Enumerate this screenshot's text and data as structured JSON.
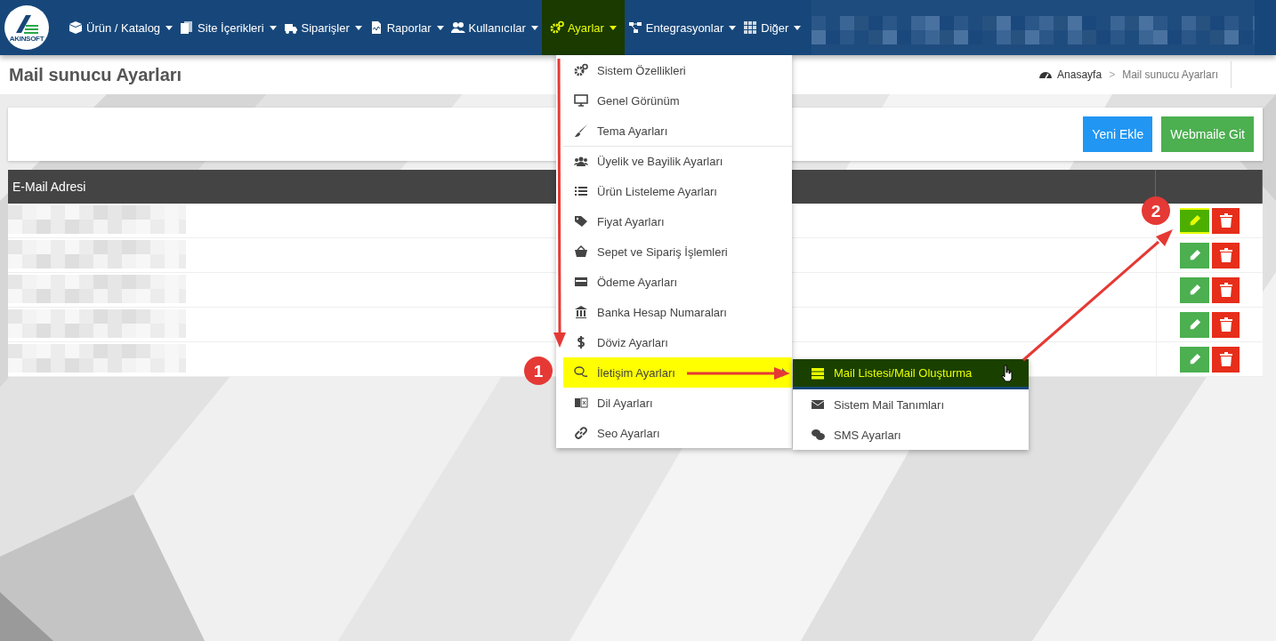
{
  "navbar": {
    "logo_text": "AKINSOFT",
    "items": [
      {
        "label": "Ürün / Katalog",
        "selected": false
      },
      {
        "label": "Site İçerikleri",
        "selected": false
      },
      {
        "label": "Siparişler",
        "selected": false
      },
      {
        "label": "Raporlar",
        "selected": false
      },
      {
        "label": "Kullanıcılar",
        "selected": false
      },
      {
        "label": "Ayarlar",
        "selected": true
      },
      {
        "label": "Entegrasyonlar",
        "selected": false
      },
      {
        "label": "Diğer",
        "selected": false
      }
    ]
  },
  "page_title": "Mail sunucu Ayarları",
  "breadcrumb": [
    "Anasayfa",
    ">",
    "Mail sunucu Ayarları"
  ],
  "toolbar": [
    {
      "label": "Yeni Ekle",
      "kind": "primary"
    },
    {
      "label": "Webmaile Git",
      "kind": "success"
    }
  ],
  "table": {
    "columns": [
      "E-Mail Adresi"
    ],
    "rows": [
      {
        "highlighted": true
      },
      {
        "highlighted": false
      },
      {
        "highlighted": false
      },
      {
        "highlighted": false
      },
      {
        "highlighted": false
      }
    ]
  },
  "dropdown": {
    "items": [
      {
        "label": "Sistem Özellikleri",
        "selected": false
      },
      {
        "label": "Genel Görünüm",
        "selected": false
      },
      {
        "label": "Tema Ayarları",
        "selected": false
      },
      {
        "label": "Üyelik ve Bayilik Ayarları",
        "selected": false
      },
      {
        "label": "Ürün Listeleme Ayarları",
        "selected": false
      },
      {
        "label": "Fiyat Ayarları",
        "selected": false
      },
      {
        "label": "Sepet ve Sipariş İşlemleri",
        "selected": false
      },
      {
        "label": "Ödeme Ayarları",
        "selected": false
      },
      {
        "label": "Banka Hesap Numaraları",
        "selected": false
      },
      {
        "label": "Döviz Ayarları",
        "selected": false
      },
      {
        "label": "İletişim Ayarları",
        "selected": true
      },
      {
        "label": "Dil Ayarları",
        "selected": false
      },
      {
        "label": "Seo Ayarları",
        "selected": false
      }
    ]
  },
  "submenu": {
    "items": [
      {
        "label": "Mail Listesi/Mail Oluşturma",
        "selected": true
      },
      {
        "label": "Sistem Mail Tanımları",
        "selected": false
      },
      {
        "label": "SMS Ayarları",
        "selected": false
      }
    ]
  },
  "annotations": [
    "1",
    "2"
  ]
}
